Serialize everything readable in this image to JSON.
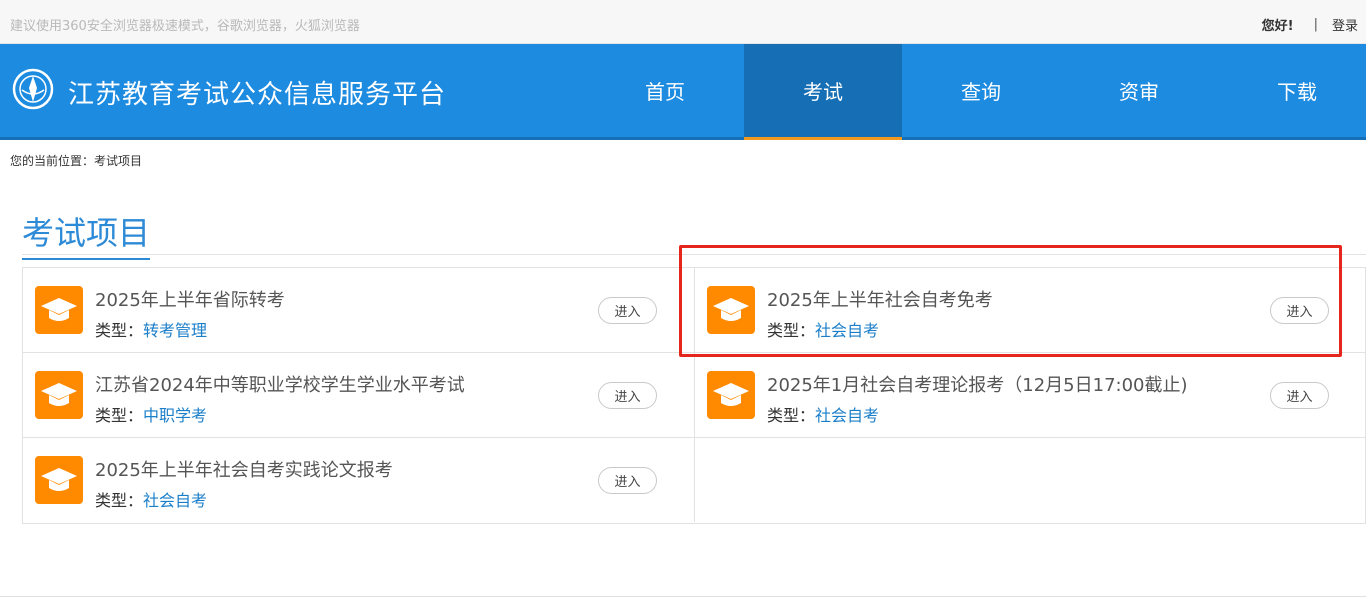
{
  "topbar": {
    "notice": "建议使用360安全浏览器极速模式，谷歌浏览器，火狐浏览器",
    "greeting": "您好!",
    "separator": "|",
    "login": "登录"
  },
  "header": {
    "site_title": "江苏教育考试公众信息服务平台",
    "nav": [
      {
        "label": "首页"
      },
      {
        "label": "考试"
      },
      {
        "label": "查询"
      },
      {
        "label": "资审"
      },
      {
        "label": "下载"
      }
    ],
    "active_nav": "考试"
  },
  "breadcrumb": "您的当前位置：考试项目",
  "section_title": "考试项目",
  "items": [
    {
      "title": "2025年上半年省际转考",
      "type_label": "类型：",
      "type": "转考管理",
      "button": "进入"
    },
    {
      "title": "2025年上半年社会自考免考",
      "type_label": "类型：",
      "type": "社会自考",
      "button": "进入"
    },
    {
      "title": "江苏省2024年中等职业学校学生学业水平考试",
      "type_label": "类型：",
      "type": "中职学考",
      "button": "进入"
    },
    {
      "title": "2025年1月社会自考理论报考（12月5日17:00截止)",
      "type_label": "类型：",
      "type": "社会自考",
      "button": "进入"
    },
    {
      "title": "2025年上半年社会自考实践论文报考",
      "type_label": "类型：",
      "type": "社会自考",
      "button": "进入"
    }
  ],
  "colors": {
    "header_blue": "#1d8be0",
    "active_nav": "#166fb5",
    "accent_orange": "#ff8a00",
    "link_blue": "#1a7ec9",
    "highlight_red": "#e5261c"
  }
}
